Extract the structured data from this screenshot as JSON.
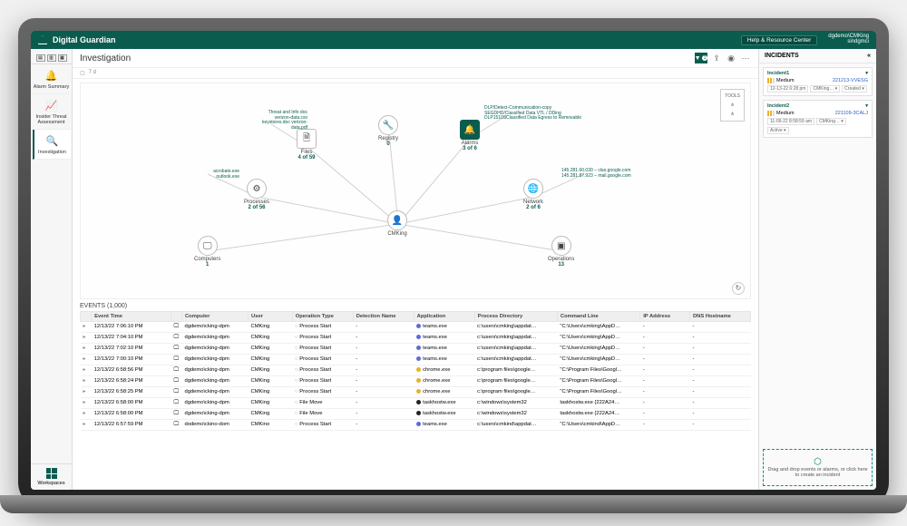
{
  "header": {
    "brand": "Digital Guardian",
    "help": "Help & Resource Center",
    "user_line1": "dgdemo\\CMKing",
    "user_line2": "sindgmci"
  },
  "rail": {
    "items": [
      {
        "label": "Alarm Summary",
        "icon": "🔔"
      },
      {
        "label": "Insider Threat Assessment",
        "icon": "📈"
      },
      {
        "label": "Investigation",
        "icon": "🔍"
      }
    ],
    "workspaces": "Workspaces"
  },
  "page": {
    "title": "Investigation",
    "range": "7 d",
    "filter_count": "1",
    "events_label": "EVENTS (1,000)"
  },
  "nodes": {
    "files": {
      "label": "Files",
      "count": "4 of 59"
    },
    "registry": {
      "label": "Registry",
      "count": "0"
    },
    "alarms": {
      "label": "Alarms",
      "count": "3 of 6"
    },
    "processes": {
      "label": "Processes",
      "count": "2 of 56"
    },
    "network": {
      "label": "Network",
      "count": "2 of 6"
    },
    "computers": {
      "label": "Computers",
      "count": "1"
    },
    "center": {
      "label": "CMKing",
      "count": ""
    },
    "operations": {
      "label": "Operations",
      "count": "13"
    }
  },
  "annotations": {
    "left1": "acrobate.exe\noutlook.exe",
    "left2": "Threat and Info doc\nverizon-data.csv\nkeystores.doc\nverizon-data.pdf",
    "top": "DLP/Detect-Communication-copy\nSEGDHD/Classified Data VTL / DDing\nDLP1510SClassified Data Egress to Removable",
    "right": "145.281.60.030 – clas.google.com\n145.281.87.923 – mail.google.com"
  },
  "tools": {
    "label": "TOOLS"
  },
  "columns": [
    "",
    "Event Time",
    "",
    "Computer",
    "User",
    "Operation Type",
    "Detection Name",
    "Application",
    "Process Directory",
    "Command Line",
    "IP Address",
    "DNS Hostname"
  ],
  "rows": [
    {
      "t": "12/13/22 7:06:10 PM",
      "c": "dgdemo\\cking-dpm",
      "u": "CMKing",
      "op": "Process Start",
      "app": "teams.exe",
      "dot": "#5b6bd6",
      "pd": "c:\\users\\cmking\\appdat…",
      "cl": "\"C:\\Users\\cmking\\AppD…"
    },
    {
      "t": "12/13/22 7:04:10 PM",
      "c": "dgdemo\\cking-dpm",
      "u": "CMKing",
      "op": "Process Start",
      "app": "teams.exe",
      "dot": "#5b6bd6",
      "pd": "c:\\users\\cmking\\appdat…",
      "cl": "\"C:\\Users\\cmking\\AppD…"
    },
    {
      "t": "12/13/22 7:02:10 PM",
      "c": "dgdemo\\cking-dpm",
      "u": "CMKing",
      "op": "Process Start",
      "app": "teams.exe",
      "dot": "#5b6bd6",
      "pd": "c:\\users\\cmking\\appdat…",
      "cl": "\"C:\\Users\\cmking\\AppD…"
    },
    {
      "t": "12/13/22 7:00:10 PM",
      "c": "dgdemo\\cking-dpm",
      "u": "CMKing",
      "op": "Process Start",
      "app": "teams.exe",
      "dot": "#5b6bd6",
      "pd": "c:\\users\\cmking\\appdat…",
      "cl": "\"C:\\Users\\cmking\\AppD…"
    },
    {
      "t": "12/13/22 6:58:56 PM",
      "c": "dgdemo\\cking-dpm",
      "u": "CMKing",
      "op": "Process Start",
      "app": "chrome.exe",
      "dot": "#e8b030",
      "pd": "c:\\program files\\google…",
      "cl": "\"C:\\Program Files\\Googl…"
    },
    {
      "t": "12/13/22 6:58:24 PM",
      "c": "dgdemo\\cking-dpm",
      "u": "CMKing",
      "op": "Process Start",
      "app": "chrome.exe",
      "dot": "#e8b030",
      "pd": "c:\\program files\\google…",
      "cl": "\"C:\\Program Files\\Googl…"
    },
    {
      "t": "12/13/22 6:58:25 PM",
      "c": "dgdemo\\cking-dpm",
      "u": "CMKing",
      "op": "Process Start",
      "app": "chrome.exe",
      "dot": "#e8b030",
      "pd": "c:\\program files\\google…",
      "cl": "\"C:\\Program Files\\Googl…"
    },
    {
      "t": "12/13/22 6:58:00 PM",
      "c": "dgdemo\\cking-dpm",
      "u": "CMKing",
      "op": "File Move",
      "app": "taskhostw.exe",
      "dot": "#222",
      "pd": "c:\\windows\\system32",
      "cl": "taskhostw.exe {222A24…"
    },
    {
      "t": "12/13/22 6:58:00 PM",
      "c": "dgdemo\\cking-dpm",
      "u": "CMKing",
      "op": "File Move",
      "app": "taskhostw.exe",
      "dot": "#222",
      "pd": "c:\\windows\\system32",
      "cl": "taskhostw.exe {222A24…"
    },
    {
      "t": "12/13/22 6:57:59 PM",
      "c": "dodemo\\ckino-dom",
      "u": "CMKino",
      "op": "Process Start",
      "app": "teams.exe",
      "dot": "#5b6bd6",
      "pd": "c:\\users\\cmkind\\appdat…",
      "cl": "\"C:\\Users\\cmkind\\AppD…"
    }
  ],
  "incidents": {
    "title": "INCIDENTS",
    "cards": [
      {
        "name": "Incident1",
        "id": "221213-VVESG",
        "sev": "Medium",
        "time": "12-13-22 6:28 pm",
        "user": "CMKing…",
        "status": "Created"
      },
      {
        "name": "Incident2",
        "id": "221109-3CALJ",
        "sev": "Medium",
        "time": "11-09-22 8:58:59 am",
        "user": "CMKing…",
        "status": "Active"
      }
    ],
    "drop": "Drag and drop events or alarms, or click here to create an incident"
  }
}
